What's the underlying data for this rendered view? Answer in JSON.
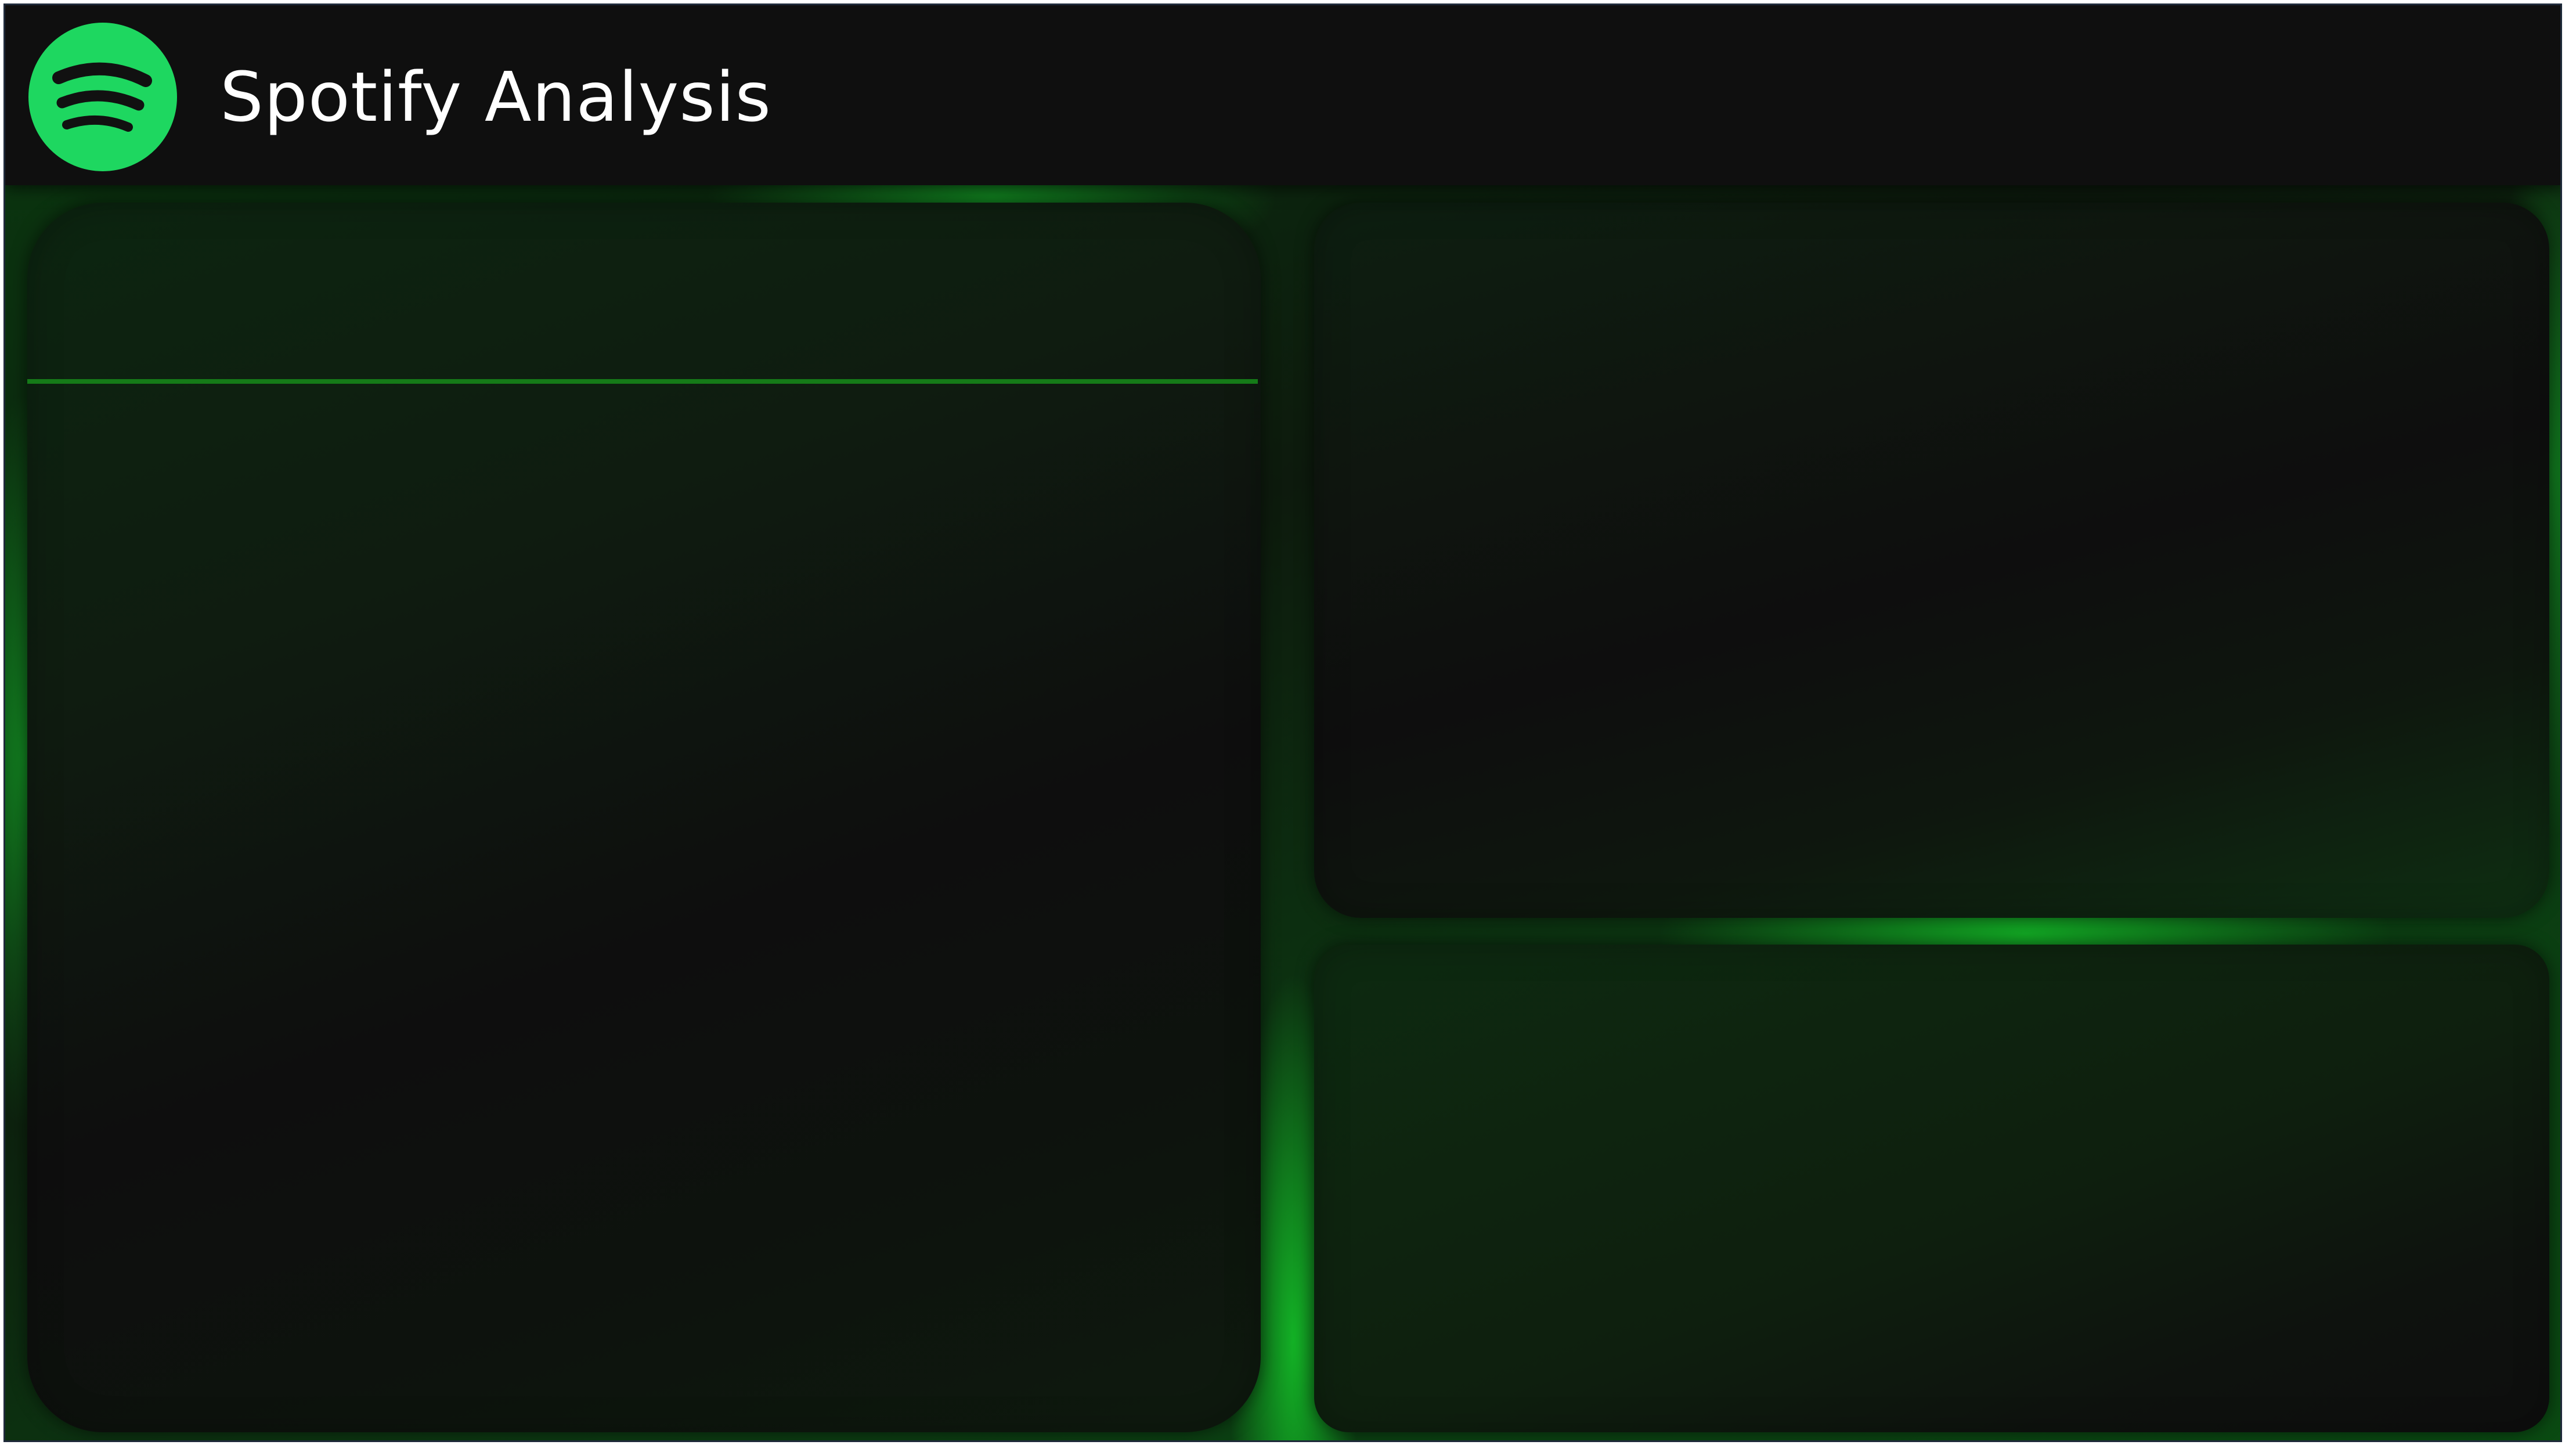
{
  "header": {
    "title": "Spotify Analysis",
    "logo_icon": "spotify-logo-icon",
    "logo_color": "#1ed760",
    "background": "#0f0f0f"
  },
  "theme": {
    "accent": "#1ed760",
    "glow": "#14be28",
    "card_background": "#0e0e0e",
    "divider_color": "#157a18"
  },
  "panels": {
    "left": {
      "title": ""
    },
    "right_top": {
      "title": ""
    },
    "right_bottom": {
      "title": ""
    }
  }
}
